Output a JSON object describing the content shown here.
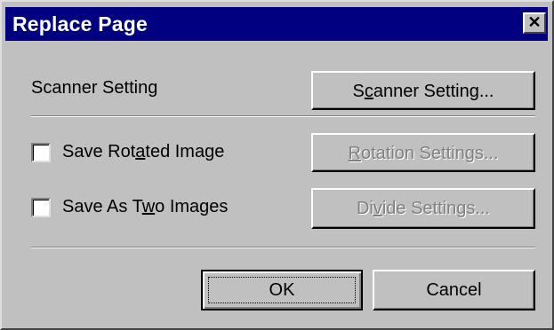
{
  "dialog": {
    "title": "Replace Page",
    "close_glyph": "✕"
  },
  "scanner": {
    "label": "Scanner Setting",
    "button_pre": "S",
    "button_mnemonic": "c",
    "button_post": "anner Setting..."
  },
  "rotate": {
    "label_pre": "Save Rot",
    "label_mnemonic": "a",
    "label_post": "ted Image",
    "checked": false,
    "button_pre": "",
    "button_mnemonic": "R",
    "button_post": "otation Settings..."
  },
  "divide": {
    "label_pre": "Save As T",
    "label_mnemonic": "w",
    "label_post": "o Images",
    "checked": false,
    "button_pre": "Di",
    "button_mnemonic": "v",
    "button_post": "ide Settings..."
  },
  "actions": {
    "ok": "OK",
    "cancel": "Cancel"
  }
}
